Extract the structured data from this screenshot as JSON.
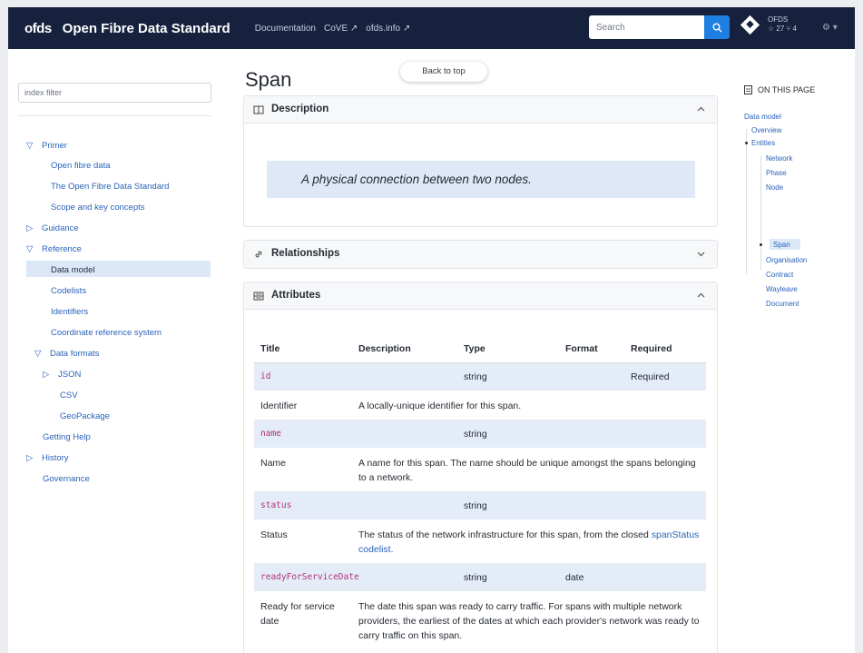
{
  "header": {
    "logo": "ofds",
    "title": "Open Fibre Data Standard",
    "nav": [
      "Documentation",
      "CoVE ↗",
      "ofds.info ↗"
    ],
    "search_placeholder": "Search",
    "repo_name": "OFDS",
    "repo_stats": "☆ 27  ⑂ 4",
    "settings": "⚙ ▾"
  },
  "sidebar": {
    "filter_placeholder": "index filter",
    "items": [
      {
        "label": "Primer",
        "toggle": "▽"
      },
      {
        "label": "Open fibre data"
      },
      {
        "label": "The Open Fibre Data Standard"
      },
      {
        "label": "Scope and key concepts"
      },
      {
        "label": "Guidance",
        "toggle": "▷"
      },
      {
        "label": "Reference",
        "toggle": "▽"
      },
      {
        "label": "Data model"
      },
      {
        "label": "Codelists"
      },
      {
        "label": "Identifiers"
      },
      {
        "label": "Coordinate reference system"
      },
      {
        "label": "Data formats",
        "toggle": "▽"
      },
      {
        "label": "JSON",
        "toggle": "▷"
      },
      {
        "label": "CSV"
      },
      {
        "label": "GeoPackage"
      },
      {
        "label": "Getting Help"
      },
      {
        "label": "History",
        "toggle": "▷"
      },
      {
        "label": "Governance"
      }
    ]
  },
  "main": {
    "title": "Span",
    "back_to_top": "Back to top",
    "description": {
      "heading": "Description",
      "text": "A physical connection between two nodes."
    },
    "relationships": {
      "heading": "Relationships"
    },
    "attributes": {
      "heading": "Attributes",
      "columns": [
        "Title",
        "Description",
        "Type",
        "Format",
        "Required"
      ],
      "rows": [
        {
          "code": "id",
          "type": "string",
          "format": "",
          "required": "Required",
          "title": "Identifier",
          "description": "A locally-unique identifier for this span.",
          "link": ""
        },
        {
          "code": "name",
          "type": "string",
          "format": "",
          "required": "",
          "title": "Name",
          "description": "A name for this span. The name should be unique amongst the spans belonging to a network.",
          "link": ""
        },
        {
          "code": "status",
          "type": "string",
          "format": "",
          "required": "",
          "title": "Status",
          "description": "The status of the network infrastructure for this span, from the closed",
          "link": "spanStatus codelist."
        },
        {
          "code": "readyForServiceDate",
          "type": "string",
          "format": "date",
          "required": "",
          "title": "Ready for service date",
          "description": "The date this span was ready to carry traffic. For spans with multiple network providers, the earliest of the dates at which each provider's network was ready to carry traffic on this span.",
          "link": ""
        }
      ]
    }
  },
  "toc": {
    "heading": "ON THIS PAGE",
    "items": [
      "Data model",
      "Overview",
      "Entities",
      "Network",
      "Phase",
      "Node",
      "Span",
      "Organisation",
      "Contract",
      "Wayleave",
      "Document"
    ]
  }
}
